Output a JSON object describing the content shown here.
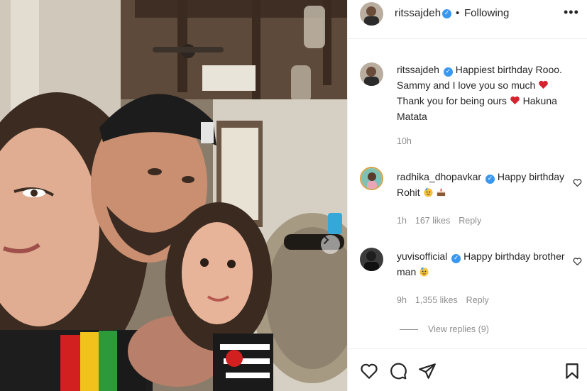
{
  "post": {
    "author": "ritssajdeh",
    "follow_status": "Following",
    "separator": "•",
    "more_icon": "more-options-icon",
    "next_icon": "chevron-right-icon"
  },
  "caption": {
    "username": "ritssajdeh",
    "text_1": "Happiest birthday Rooo. Sammy and I love you so much",
    "text_2": "Thank you for being ours",
    "text_3": "Hakuna Matata",
    "time": "10h"
  },
  "comments": [
    {
      "username": "radhika_dhopavkar",
      "text_1": "Happy birthday Rohit",
      "time": "1h",
      "likes": "167 likes",
      "reply": "Reply"
    },
    {
      "username": "yuvisofficial",
      "text_1": "Happy birthday brother man",
      "time": "9h",
      "likes": "1,355 likes",
      "reply": "Reply"
    }
  ],
  "view_replies": "View replies (9)",
  "colors": {
    "verified": "#3897f0",
    "heart": "#ed4956",
    "muted": "#8e8e8e"
  },
  "actions": [
    "like-icon",
    "comment-icon",
    "share-icon",
    "save-icon"
  ]
}
